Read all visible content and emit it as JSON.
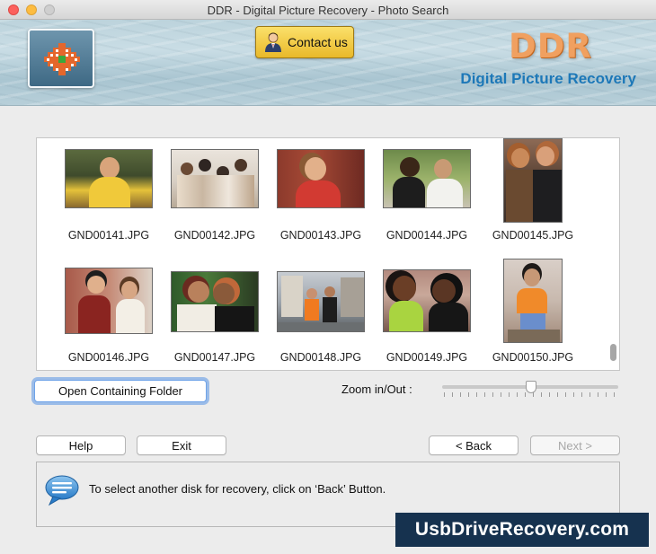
{
  "window": {
    "title": "DDR - Digital Picture Recovery - Photo Search"
  },
  "header": {
    "contact_label": "Contact us",
    "brand": "DDR",
    "brand_subtitle": "Digital Picture Recovery"
  },
  "gallery": {
    "items": [
      {
        "file": "GND00141.JPG"
      },
      {
        "file": "GND00142.JPG"
      },
      {
        "file": "GND00143.JPG"
      },
      {
        "file": "GND00144.JPG"
      },
      {
        "file": "GND00145.JPG"
      },
      {
        "file": "GND00146.JPG"
      },
      {
        "file": "GND00147.JPG"
      },
      {
        "file": "GND00148.JPG"
      },
      {
        "file": "GND00149.JPG"
      },
      {
        "file": "GND00150.JPG"
      }
    ]
  },
  "controls": {
    "open_folder_label": "Open Containing Folder",
    "zoom_label": "Zoom in/Out :"
  },
  "footer": {
    "help_label": "Help",
    "exit_label": "Exit",
    "back_label": "< Back",
    "next_label": "Next >"
  },
  "message": {
    "text": "To select another disk for recovery, click on ‘Back’ Button."
  },
  "watermark": {
    "text": "UsbDriveRecovery.com"
  },
  "colors": {
    "brand_orange": "#f0a060",
    "subtitle_blue": "#1d78b8",
    "watermark_bg": "#16324f"
  },
  "icons": [
    "app-logo-icon",
    "contact-person-icon",
    "speech-bubble-icon"
  ]
}
